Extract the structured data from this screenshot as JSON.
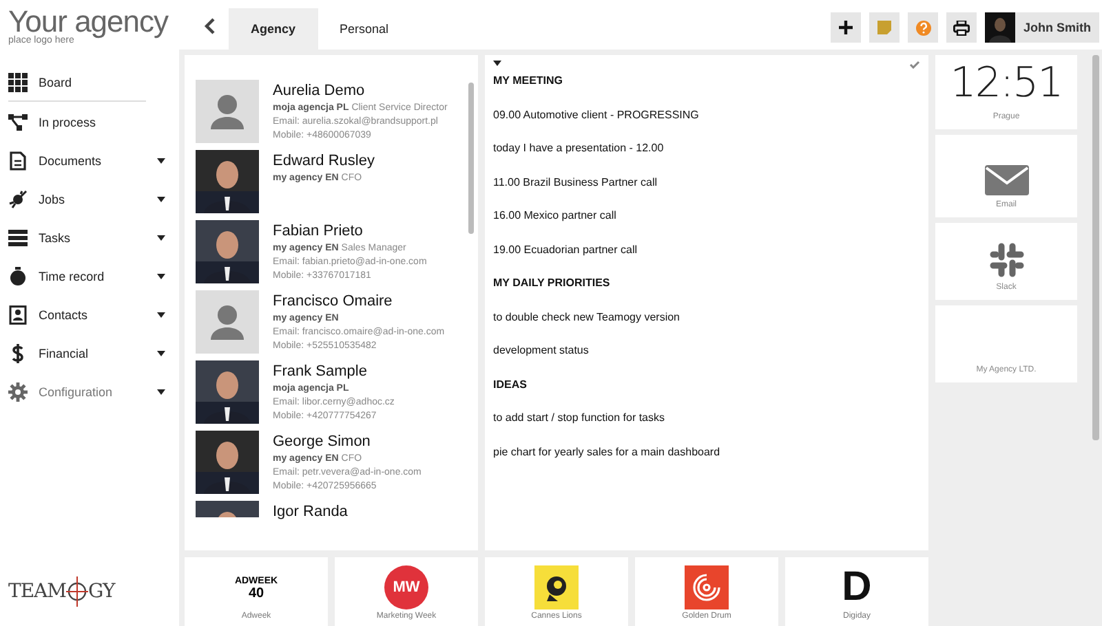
{
  "brand": {
    "title": "Your agency",
    "subtitle": "place logo here"
  },
  "sidebar": {
    "items": [
      {
        "label": "Board",
        "kind": "grid",
        "has_menu": false,
        "disabled": false
      },
      {
        "label": "In process",
        "kind": "flow",
        "has_menu": false,
        "disabled": false
      },
      {
        "label": "Documents",
        "kind": "doc",
        "has_menu": true,
        "disabled": false
      },
      {
        "label": "Jobs",
        "kind": "rocket",
        "has_menu": true,
        "disabled": false
      },
      {
        "label": "Tasks",
        "kind": "tasks",
        "has_menu": true,
        "disabled": false
      },
      {
        "label": "Time record",
        "kind": "timer",
        "has_menu": true,
        "disabled": false
      },
      {
        "label": "Contacts",
        "kind": "contact",
        "has_menu": true,
        "disabled": false
      },
      {
        "label": "Financial",
        "kind": "dollar",
        "has_menu": true,
        "disabled": false
      },
      {
        "label": "Configuration",
        "kind": "gear",
        "has_menu": true,
        "disabled": true
      }
    ]
  },
  "footer_logo": {
    "before": "TEAM",
    "after": "GY"
  },
  "tabs": [
    {
      "label": "Agency",
      "selected": true
    },
    {
      "label": "Personal",
      "selected": false
    }
  ],
  "toolbar": {
    "buttons": [
      {
        "kind": "add"
      },
      {
        "kind": "note"
      },
      {
        "kind": "help"
      },
      {
        "kind": "print"
      }
    ],
    "user": "John Smith"
  },
  "contacts": [
    {
      "name": "Aurelia Demo",
      "agency": "moja agencja PL",
      "role": "Client Service Director",
      "email": "Email: aurelia.szokal@brandsupport.pl",
      "mobile": "Mobile: +48600067039",
      "kind": "placeholder"
    },
    {
      "name": "Edward Rusley",
      "agency": "my agency EN",
      "role": "CFO"
    },
    {
      "name": "Fabian Prieto",
      "agency": "my agency EN",
      "role": "Sales Manager",
      "email": "Email: fabian.prieto@ad-in-one.com",
      "mobile": "Mobile: +33767017181"
    },
    {
      "name": "Francisco Omaire",
      "agency": "my agency EN",
      "email": "Email: francisco.omaire@ad-in-one.com",
      "mobile": "Mobile: +525510535482",
      "kind": "placeholder"
    },
    {
      "name": "Frank Sample",
      "agency": "moja agencja PL",
      "email": "Email: libor.cerny@adhoc.cz",
      "mobile": "Mobile: +420777754267"
    },
    {
      "name": "George Simon",
      "agency": "my agency EN",
      "role": "CFO",
      "email": "Email: petr.vevera@ad-in-one.com",
      "mobile": "Mobile: +420725956665"
    },
    {
      "name": "Igor Randa"
    }
  ],
  "notes": [
    {
      "kind": "heading",
      "text": "MY MEETING"
    },
    {
      "kind": "text",
      "text": "09.00 Automotive client - PROGRESSING"
    },
    {
      "kind": "text",
      "text": "today I have a presentation - 12.00"
    },
    {
      "kind": "text",
      "text": "11.00 Brazil Business Partner call"
    },
    {
      "kind": "text",
      "text": "16.00 Mexico partner call"
    },
    {
      "kind": "text",
      "text": "19.00 Ecuadorian partner call"
    },
    {
      "kind": "heading",
      "text": "MY DAILY PRIORITIES"
    },
    {
      "kind": "text",
      "text": "to double check new Teamogy version"
    },
    {
      "kind": "text",
      "text": "development status"
    },
    {
      "kind": "heading",
      "text": "IDEAS"
    },
    {
      "kind": "text",
      "text": "to add start / stop function  for tasks"
    },
    {
      "kind": "text",
      "text": "pie chart for yearly sales for a main dashboard"
    }
  ],
  "widgets": [
    {
      "kind": "clock",
      "time": "12:51",
      "label": "Prague"
    },
    {
      "kind": "email",
      "label": "Email"
    },
    {
      "kind": "slack",
      "label": "Slack"
    },
    {
      "kind": "blank",
      "label": "My Agency LTD."
    }
  ],
  "links": [
    {
      "kind": "adweek",
      "label": "Adweek",
      "logo_text": "ADWEEK",
      "logo_sub": "40"
    },
    {
      "kind": "mw",
      "label": "Marketing Week",
      "logo_text": "MW"
    },
    {
      "kind": "cannes",
      "label": "Cannes Lions"
    },
    {
      "kind": "drum",
      "label": "Golden Drum"
    },
    {
      "kind": "digiday",
      "label": "Digiday",
      "logo_text": "D"
    }
  ]
}
